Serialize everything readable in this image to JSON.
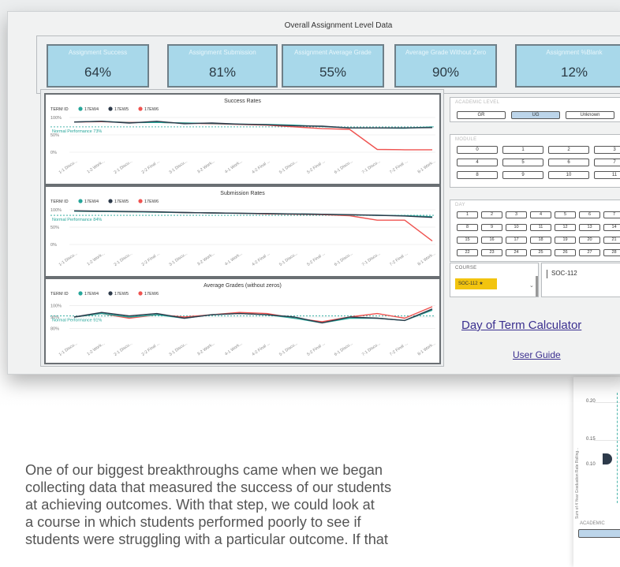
{
  "dashboard": {
    "title": "Overall Assignment Level Data",
    "kpis": [
      {
        "label": "Assignment Success",
        "value": "64%"
      },
      {
        "label": "Assignment Submission",
        "value": "81%"
      },
      {
        "label": "Assignment Average Grade",
        "value": "55%"
      },
      {
        "label": "Average Grade Without Zero",
        "value": "90%"
      },
      {
        "label": "Assignment %Blank",
        "value": "12%"
      }
    ],
    "legend_label": "TERM ID",
    "legend_items": [
      "17EW4",
      "17EW5",
      "17EW6"
    ],
    "x_labels": [
      "1-1 Discu...",
      "1-2 Work...",
      "2-1 Discu...",
      "2-2 Final ...",
      "3-1 Discu...",
      "3-2 Work...",
      "4-1 Work...",
      "4-2 Final ...",
      "5-1 Discu...",
      "5-2 Final ...",
      "6-1 Discu...",
      "7-1 Discu...",
      "7-2 Final ...",
      "8-1 Work..."
    ]
  },
  "chart_data": [
    {
      "type": "line",
      "title": "Success Rates",
      "y_ticks": [
        "100%",
        "50%",
        "0%"
      ],
      "ylim": [
        0,
        100
      ],
      "categories": [
        "1-1 Discu...",
        "1-2 Work...",
        "2-1 Discu...",
        "2-2 Final ...",
        "3-1 Discu...",
        "3-2 Work...",
        "4-1 Work...",
        "4-2 Final ...",
        "5-1 Discu...",
        "5-2 Final ...",
        "6-1 Discu...",
        "7-1 Discu...",
        "7-2 Final ...",
        "8-1 Work..."
      ],
      "reference": {
        "label": "Normal Performance 73%",
        "value": 73
      },
      "series": [
        {
          "name": "17EW4",
          "color": "#26a69a",
          "values": [
            87,
            89,
            85,
            86,
            84,
            83,
            81,
            80,
            78,
            74,
            70,
            70,
            69,
            73
          ]
        },
        {
          "name": "17EW5",
          "color": "#2d3a4a",
          "values": [
            87,
            89,
            84,
            89,
            82,
            84,
            81,
            79,
            76,
            75,
            70,
            70,
            70,
            71
          ]
        },
        {
          "name": "17EW6",
          "color": "#ef5350",
          "values": [
            87,
            88,
            86,
            86,
            84,
            82,
            80,
            78,
            73,
            68,
            66,
            8,
            7,
            7
          ]
        }
      ]
    },
    {
      "type": "line",
      "title": "Submission Rates",
      "y_ticks": [
        "100%",
        "50%",
        "0%"
      ],
      "ylim": [
        0,
        100
      ],
      "categories": [
        "1-1 Discu...",
        "1-2 Work...",
        "2-1 Discu...",
        "2-2 Final ...",
        "3-1 Discu...",
        "3-2 Work...",
        "4-1 Work...",
        "4-2 Final ...",
        "5-1 Discu...",
        "5-2 Final ...",
        "6-1 Discu...",
        "7-1 Discu...",
        "7-2 Final ...",
        "8-1 Work..."
      ],
      "reference": {
        "label": "Normal Performance 84%",
        "value": 84
      },
      "series": [
        {
          "name": "17EW4",
          "color": "#26a69a",
          "values": [
            96,
            95,
            94,
            93,
            92,
            91,
            90,
            89,
            88,
            87,
            85,
            84,
            83,
            80
          ]
        },
        {
          "name": "17EW5",
          "color": "#2d3a4a",
          "values": [
            97,
            96,
            95,
            94,
            92,
            91,
            90,
            89,
            88,
            87,
            86,
            84,
            82,
            78
          ]
        },
        {
          "name": "17EW6",
          "color": "#ef5350",
          "values": [
            96,
            95,
            94,
            93,
            92,
            91,
            90,
            88,
            87,
            86,
            83,
            70,
            70,
            10
          ]
        }
      ]
    },
    {
      "type": "line",
      "title": "Average Grades (without zeros)",
      "y_ticks": [
        "100%",
        "90%",
        "80%"
      ],
      "ylim": [
        75,
        103
      ],
      "categories": [
        "1-1 Discu...",
        "1-2 Work...",
        "2-1 Discu...",
        "2-2 Final ...",
        "3-1 Discu...",
        "3-2 Work...",
        "4-1 Work...",
        "4-2 Final ...",
        "5-1 Discu...",
        "5-2 Final ...",
        "6-1 Discu...",
        "7-1 Discu...",
        "7-2 Final ...",
        "8-1 Work..."
      ],
      "reference": {
        "label": "Normal Performance 91%",
        "value": 91
      },
      "series": [
        {
          "name": "17EW4",
          "color": "#26a69a",
          "values": [
            90,
            93,
            90,
            92,
            89,
            92,
            93,
            92,
            89,
            85,
            89,
            89,
            87,
            96
          ]
        },
        {
          "name": "17EW5",
          "color": "#2d3a4a",
          "values": [
            90,
            94,
            91,
            93,
            89,
            92,
            93,
            92,
            90,
            85,
            90,
            89,
            87,
            97
          ]
        },
        {
          "name": "17EW6",
          "color": "#ef5350",
          "values": [
            90,
            93,
            89,
            92,
            90,
            92,
            94,
            93,
            89,
            86,
            90,
            93,
            89,
            99
          ]
        }
      ]
    }
  ],
  "slicers": {
    "academic_level": {
      "label": "ACADEMIC LEVEL",
      "options": [
        "GR",
        "UG",
        "Unknown"
      ],
      "selected": "UG"
    },
    "module": {
      "label": "MODULE",
      "options": [
        "0",
        "1",
        "2",
        "3",
        "4",
        "5",
        "6",
        "7",
        "8",
        "9",
        "10",
        "11"
      ]
    },
    "day": {
      "label": "DAY",
      "options": [
        "1",
        "2",
        "3",
        "4",
        "5",
        "6",
        "7",
        "8",
        "9",
        "10",
        "11",
        "12",
        "13",
        "14",
        "15",
        "16",
        "17",
        "18",
        "19",
        "20",
        "21",
        "22",
        "23",
        "24",
        "25",
        "26",
        "27",
        "28"
      ]
    },
    "course": {
      "label": "COURSE",
      "chip": "SOC-112",
      "card": "SOC-112"
    }
  },
  "links": {
    "day_of_term": "Day of Term Calculator",
    "user_guide": "User Guide"
  },
  "colors": {
    "kpi_fill": "#a8d8ea",
    "link": "#3a2f8f",
    "teal": "#26a69a",
    "navy": "#2d3a4a",
    "red": "#ef5350",
    "chip": "#f2c40f"
  },
  "article": {
    "lines": [
      "One of our biggest breakthroughs came when we began",
      "collecting data that measured the success of our students",
      "at achieving outcomes. With that step, we could look at",
      "a course in which students performed poorly to see if",
      "students were struggling with a particular outcome. If that"
    ]
  },
  "peek": {
    "y_label": "Sum of 4 Year Graduation Rate Rolling...",
    "ticks": [
      "0.20",
      "0.15",
      "0.10"
    ],
    "slicer_label": "ACADEMIC"
  }
}
